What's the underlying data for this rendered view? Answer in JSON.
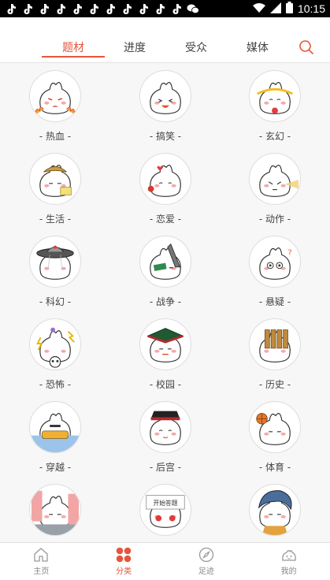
{
  "status": {
    "time": "10:15",
    "notification_icons": [
      "tiktok-icon",
      "tiktok-icon",
      "tiktok-icon",
      "tiktok-icon",
      "tiktok-icon",
      "tiktok-icon",
      "tiktok-icon",
      "tiktok-icon",
      "tiktok-icon",
      "tiktok-icon",
      "tiktok-icon",
      "wechat-icon"
    ]
  },
  "tabs": [
    {
      "label": "题材",
      "active": true
    },
    {
      "label": "进度",
      "active": false
    },
    {
      "label": "受众",
      "active": false
    },
    {
      "label": "媒体",
      "active": false
    }
  ],
  "categories": [
    {
      "label": "- 热血 -",
      "icon": "hot-blood-bun-icon"
    },
    {
      "label": "- 搞笑 -",
      "icon": "funny-bun-icon"
    },
    {
      "label": "- 玄幻 -",
      "icon": "fantasy-bun-icon"
    },
    {
      "label": "- 生活 -",
      "icon": "life-bun-icon"
    },
    {
      "label": "- 恋爱 -",
      "icon": "romance-bun-icon"
    },
    {
      "label": "- 动作 -",
      "icon": "action-bun-icon"
    },
    {
      "label": "- 科幻 -",
      "icon": "scifi-bun-icon"
    },
    {
      "label": "- 战争 -",
      "icon": "war-bun-icon"
    },
    {
      "label": "- 悬疑 -",
      "icon": "mystery-bun-icon"
    },
    {
      "label": "- 恐怖 -",
      "icon": "horror-bun-icon"
    },
    {
      "label": "- 校园 -",
      "icon": "campus-bun-icon"
    },
    {
      "label": "- 历史 -",
      "icon": "history-bun-icon"
    },
    {
      "label": "- 穿越 -",
      "icon": "time-travel-bun-icon"
    },
    {
      "label": "- 后宫 -",
      "icon": "harem-bun-icon"
    },
    {
      "label": "- 体育 -",
      "icon": "sports-bun-icon"
    },
    {
      "label": "",
      "icon": "city-bun-icon"
    },
    {
      "label": "",
      "icon": "sign-bun-icon",
      "sign_text": "开始答题"
    },
    {
      "label": "",
      "icon": "anime-bun-icon"
    }
  ],
  "bottom_nav": [
    {
      "label": "主页",
      "icon": "home-icon",
      "active": false
    },
    {
      "label": "分类",
      "icon": "category-icon",
      "active": true
    },
    {
      "label": "足迹",
      "icon": "compass-icon",
      "active": false
    },
    {
      "label": "我的",
      "icon": "profile-bun-icon",
      "active": false
    }
  ],
  "colors": {
    "accent": "#e5553b"
  }
}
